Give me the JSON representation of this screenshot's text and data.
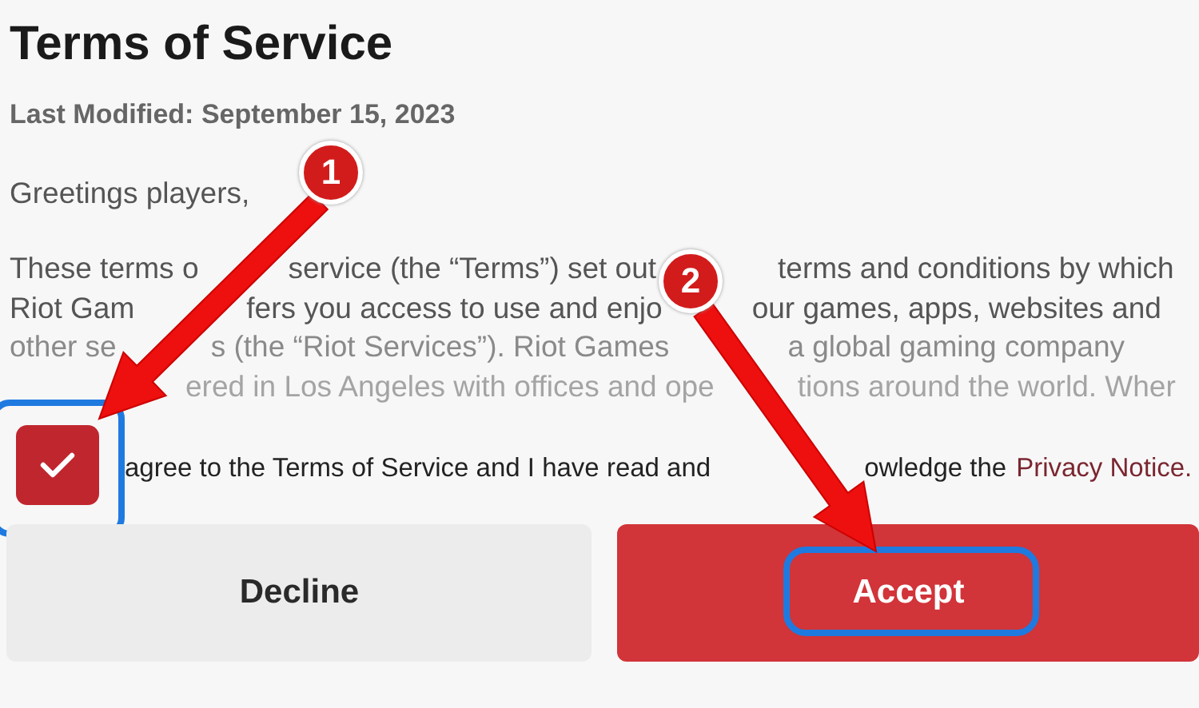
{
  "title": "Terms of Service",
  "last_modified": "Last Modified: September 15, 2023",
  "greeting": "Greetings players,",
  "paragraph_lines": [
    {
      "fragments": [
        "These terms o",
        "service (the “Terms”) set out",
        "terms and conditions by which"
      ]
    },
    {
      "fragments": [
        "Riot Gam",
        "fers you access to use and enjo",
        "our games, apps, websites and"
      ]
    },
    {
      "fragments": [
        "other se",
        "s (the “Riot Services”). Riot Games",
        "a global gaming company"
      ]
    },
    {
      "fragments": [
        "ered in Los Angeles with offices and ope",
        "tions around the world. Wher"
      ]
    }
  ],
  "consent": {
    "checked": true,
    "highlighted": true,
    "label_fragments": [
      "agree to the Terms of Service and I have read and",
      "owledge the"
    ],
    "link": "Privacy Notice."
  },
  "buttons": [
    {
      "label": "Decline",
      "kind": "secondary",
      "highlighted": false
    },
    {
      "label": "Accept",
      "kind": "primary",
      "highlighted": true
    }
  ],
  "annotations": [
    {
      "number": "1"
    },
    {
      "number": "2"
    }
  ]
}
